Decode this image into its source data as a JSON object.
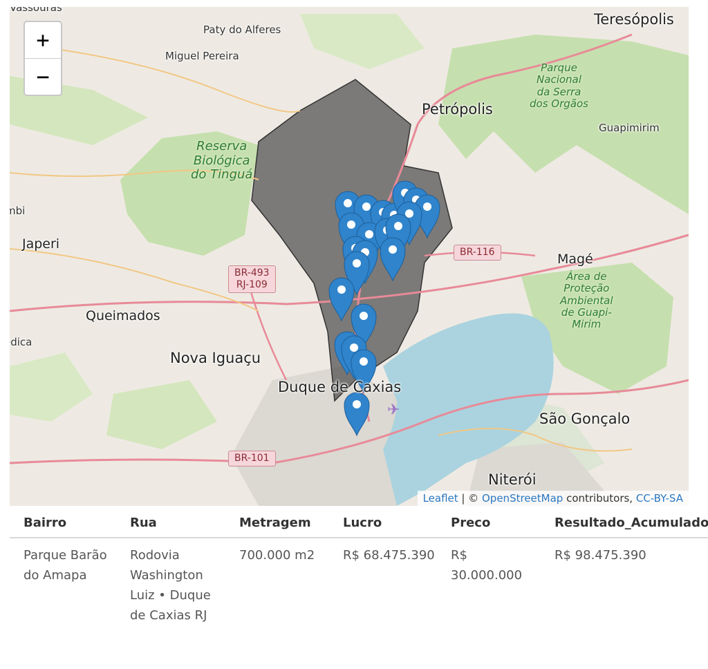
{
  "map": {
    "zoom_in_label": "+",
    "zoom_out_label": "−",
    "places": {
      "teresopolis": "Teresópolis",
      "paty": "Paty do Alferes",
      "miguel": "Miguel Pereira",
      "petropolis": "Petrópolis",
      "guapimirim": "Guapimirim",
      "japeri": "Japeri",
      "mage": "Magé",
      "queimados": "Queimados",
      "nova_iguacu": "Nova Iguaçu",
      "duque": "Duque de Caxias",
      "sao_goncalo": "São Gonçalo",
      "niteroi": "Niterói",
      "vassouras": "Vassouras",
      "edica": "edica",
      "mbi": "mbi"
    },
    "parks": {
      "serra_orgaos": "Parque\nNacional\nda Serra\ndos Orgãos",
      "tingua": "Reserva\nBiológica\ndo Tinguá",
      "guapi_mirim": "Área de\nProteção\nAmbiental\nde Guapi-\nMirim"
    },
    "shields": {
      "br116": "BR-116",
      "br493": "BR-493\nRJ-109",
      "br101": "BR-101"
    },
    "marker_color": "#2f84cc",
    "attribution": {
      "leaflet": "Leaflet",
      "sep": " | © ",
      "osm": "OpenStreetMap",
      "contributors": " contributors, ",
      "license": "CC-BY-SA"
    }
  },
  "table": {
    "headers": [
      "Bairro",
      "Rua",
      "Metragem",
      "Lucro",
      "Preco",
      "Resultado_Acumulado"
    ],
    "rows": [
      {
        "bairro": "Parque Barão do Amapa",
        "rua": "Rodovia Washington Luiz • Duque de Caxias RJ",
        "metragem": "700.000 m2",
        "lucro": "R$ 68.475.390",
        "preco": "R$ 30.000.000",
        "resultado": "R$ 98.475.390"
      }
    ]
  }
}
